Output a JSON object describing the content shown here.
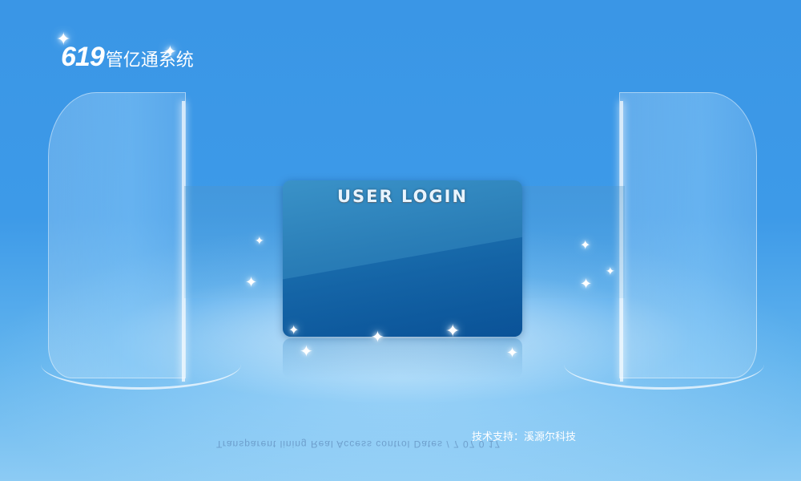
{
  "app": {
    "logo_number": "619",
    "logo_name": "管亿通系统"
  },
  "login_card": {
    "title": "USER LOGIN"
  },
  "footer": {
    "support_text": "技术支持：溪源尔科技",
    "mirrored_caption": "Transparent lining Real Access control Dates / 7 07 0 17"
  },
  "decor": {
    "sparkle_icon": "sparkle-icon",
    "accent": "#3a96e6"
  }
}
